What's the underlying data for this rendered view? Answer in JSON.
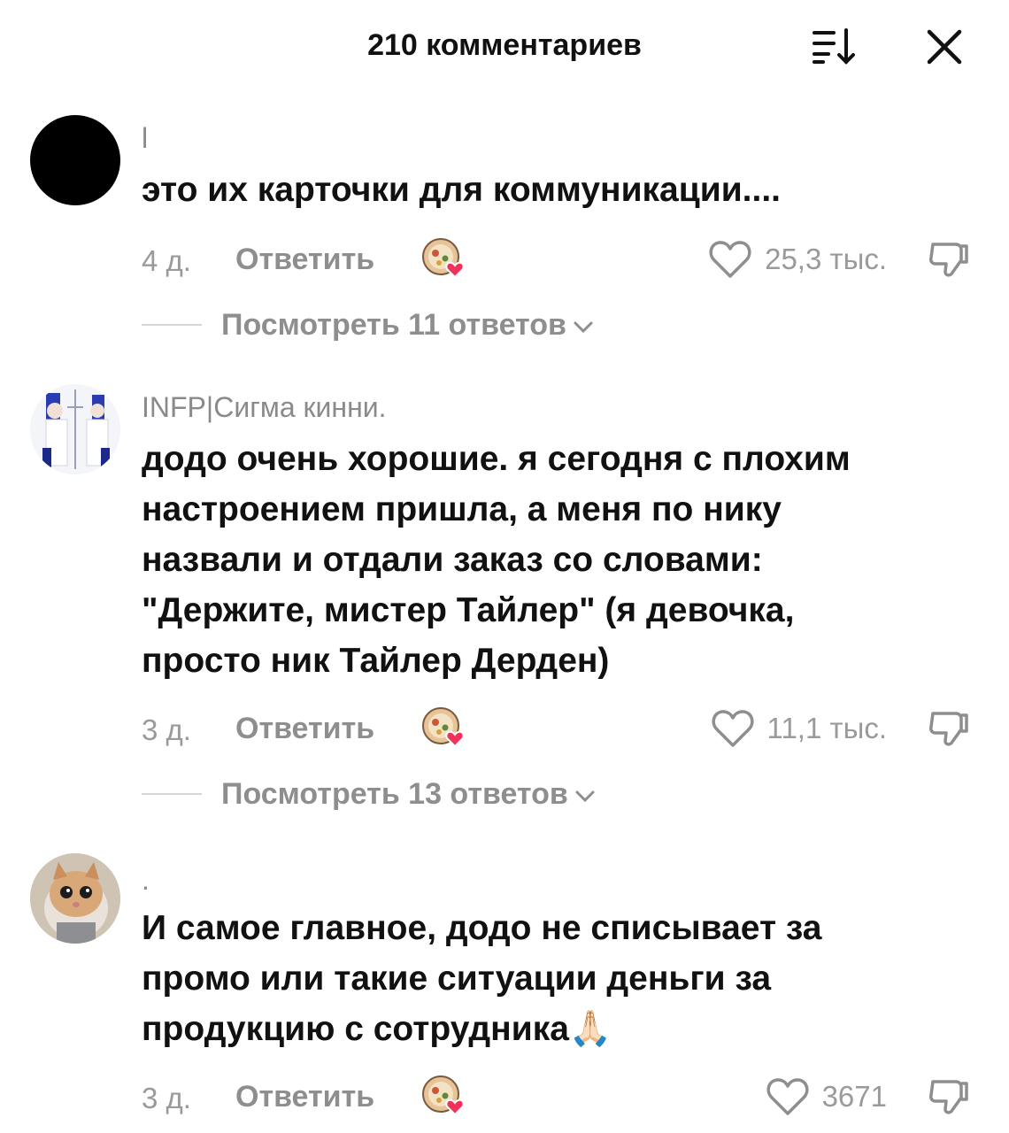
{
  "header": {
    "title": "210 комментариев"
  },
  "comments": [
    {
      "username": "l",
      "text": "это их карточки для коммуникации....",
      "date": "4 д.",
      "reply_label": "Ответить",
      "likes": "25,3 тыс.",
      "replies_label": "Посмотреть 11 ответов"
    },
    {
      "username": "INFP|Сигма кинни.",
      "text": "додо очень хорошие. я сегодня с плохим настроением пришла, а меня по нику назвали и отдали заказ со словами: \"Держите, мистер Тайлер\" (я девочка, просто ник Тайлер Дерден)",
      "date": "3 д.",
      "reply_label": "Ответить",
      "likes": "11,1 тыс.",
      "replies_label": "Посмотреть 13 ответов"
    },
    {
      "username": ".",
      "text": "И самое главное, додо не списывает за промо или такие ситуации деньги за продукцию с сотрудника🙏🏻",
      "date": "3 д.",
      "reply_label": "Ответить",
      "likes": "3671"
    }
  ],
  "icons": {
    "sort": "sort-icon",
    "close": "close-icon",
    "like": "heart-outline-icon",
    "dislike": "thumbs-down-icon",
    "creator_like": "creator-liked-icon",
    "chevron": "chevron-down-icon"
  },
  "colors": {
    "creator_heart": "#f0325a",
    "secondary_text": "#8e8e8e"
  }
}
